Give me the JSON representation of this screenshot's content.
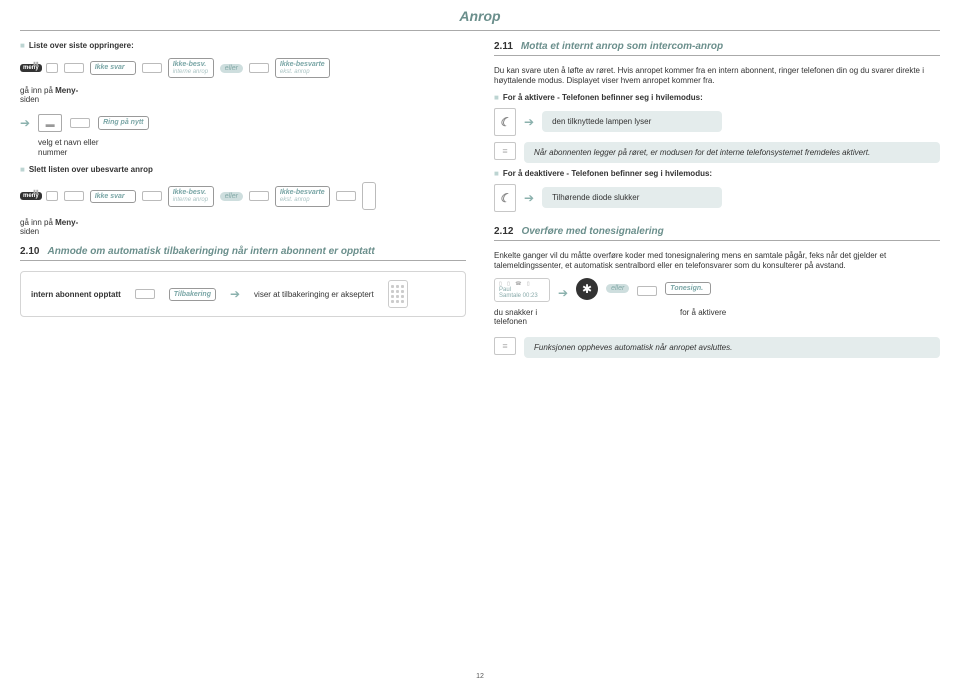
{
  "title": "Anrop",
  "left": {
    "list_label": "Liste over siste oppringere:",
    "menu_label": "meny",
    "display_noanswer": "Ikke svar",
    "display_unansw_int": {
      "l1": "Ikke-besv.",
      "l2": "interne anrop"
    },
    "display_unansw_ext": {
      "l1": "Ikke-besvarte",
      "l2": "ekst. anrop"
    },
    "or": "eller",
    "goto_full": "gå inn på Meny-siden",
    "ring_again": "Ring på nytt",
    "velg": "velg et navn eller nummer",
    "slett_label": "Slett listen over ubesvarte anrop",
    "section210_num": "2.10",
    "section210_title": "Anmode om automatisk tilbakeringing når intern abonnent er opptatt",
    "intern_opptatt": "intern abonnent opptatt",
    "tilbakering": "Tilbakering",
    "viser": "viser at tilbakeringing er akseptert"
  },
  "right": {
    "section211_num": "2.11",
    "section211_title": "Motta et internt anrop som intercom-anrop",
    "para211": "Du kan svare uten å løfte av røret. Hvis anropet kommer fra en intern abonnent, ringer telefonen din og du svarer direkte i høyttalende modus. Displayet viser hvem anropet kommer fra.",
    "activate": "For å aktivere - Telefonen befinner seg i hvilemodus:",
    "lamp_on": "den tilknyttede lampen lyser",
    "note1": "Når abonnenten legger på røret, er modusen for det interne telefonsystemet fremdeles aktivert.",
    "deactivate": "For å deaktivere - Telefonen befinner seg i hvilemodus:",
    "lamp_off": "Tilhørende diode slukker",
    "section212_num": "2.12",
    "section212_title": "Overføre med tonesignalering",
    "para212": "Enkelte ganger vil du måtte overføre koder med tonesignalering mens en samtale pågår, feks når det gjelder et talemeldingssenter, et automatisk sentralbord eller en telefonsvarer som du konsulterer på avstand.",
    "call_name": "Paul",
    "call_dur": "Samtale 00:23",
    "tonesign": "Tonesign.",
    "du_snakker": "du snakker i telefonen",
    "for_aktivere": "for å aktivere",
    "note2": "Funksjonen oppheves automatisk når anropet avsluttes."
  },
  "page": "12"
}
